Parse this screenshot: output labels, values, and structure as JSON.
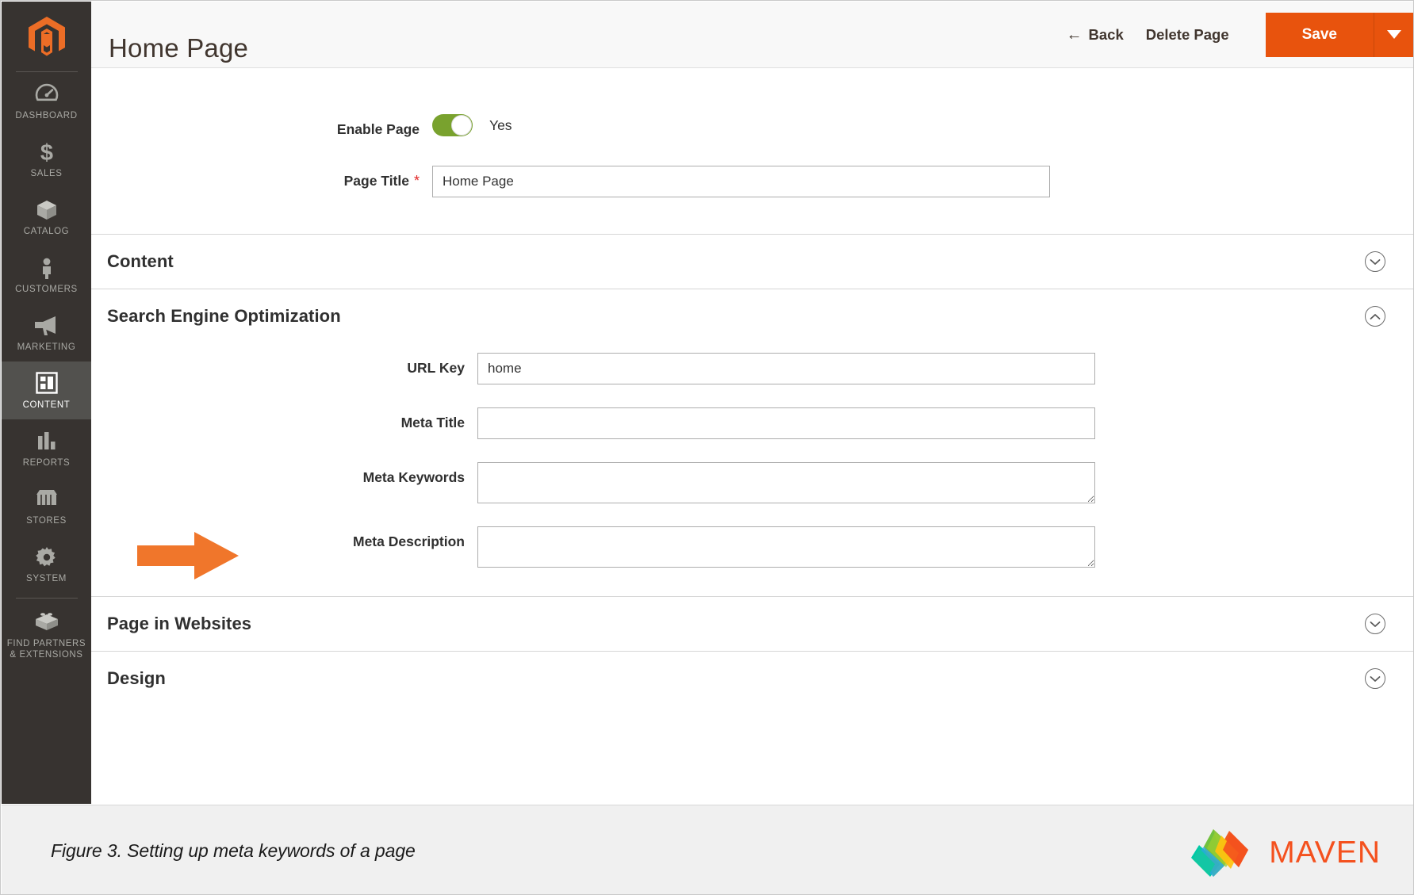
{
  "header": {
    "title": "Home Page",
    "back_label": "Back",
    "back_icon": "arrow-left-icon",
    "delete_label": "Delete Page",
    "save_label": "Save",
    "save_caret_icon": "caret-down-icon"
  },
  "sidebar": {
    "logo_icon": "magento-logo-icon",
    "items": [
      {
        "label": "DASHBOARD",
        "icon": "dashboard-gauge-icon",
        "active": false
      },
      {
        "label": "SALES",
        "icon": "dollar-sign-icon",
        "active": false
      },
      {
        "label": "CATALOG",
        "icon": "box-icon",
        "active": false
      },
      {
        "label": "CUSTOMERS",
        "icon": "person-icon",
        "active": false
      },
      {
        "label": "MARKETING",
        "icon": "megaphone-icon",
        "active": false
      },
      {
        "label": "CONTENT",
        "icon": "layout-page-icon",
        "active": true
      },
      {
        "label": "REPORTS",
        "icon": "bar-chart-icon",
        "active": false
      },
      {
        "label": "STORES",
        "icon": "storefront-icon",
        "active": false
      },
      {
        "label": "SYSTEM",
        "icon": "gear-icon",
        "active": false
      },
      {
        "label": "FIND PARTNERS & EXTENSIONS",
        "icon": "lego-brick-icon",
        "active": false
      }
    ]
  },
  "form": {
    "enable_page": {
      "label": "Enable Page",
      "state_text": "Yes",
      "on": true,
      "track_color": "#79a22e"
    },
    "page_title": {
      "label": "Page Title",
      "required_marker": "*",
      "value": "Home Page",
      "placeholder": ""
    }
  },
  "sections": [
    {
      "id": "content",
      "title": "Content",
      "expanded": false,
      "toggle_icon": "chevron-down-icon"
    },
    {
      "id": "seo",
      "title": "Search Engine Optimization",
      "expanded": true,
      "toggle_icon": "chevron-up-icon"
    },
    {
      "id": "websites",
      "title": "Page in Websites",
      "expanded": false,
      "toggle_icon": "chevron-down-icon"
    },
    {
      "id": "design",
      "title": "Design",
      "expanded": false,
      "toggle_icon": "chevron-down-icon"
    }
  ],
  "seo_fields": {
    "url_key": {
      "label": "URL Key",
      "value": "home",
      "placeholder": ""
    },
    "meta_title": {
      "label": "Meta Title",
      "value": "",
      "placeholder": ""
    },
    "meta_keywords": {
      "label": "Meta Keywords",
      "value": "",
      "placeholder": ""
    },
    "meta_description": {
      "label": "Meta Description",
      "value": "",
      "placeholder": ""
    }
  },
  "annotation": {
    "arrow_icon": "orange-right-arrow-icon",
    "color": "#f0762b",
    "points_to": "Meta Keywords"
  },
  "footer": {
    "caption": "Figure 3. Setting up meta keywords of a page",
    "brand_name": "MAVEN",
    "brand_icon": "maven-diamonds-logo-icon",
    "brand_color": "#f4511e"
  },
  "colors": {
    "accent_orange": "#e8530d",
    "sidebar_bg": "#373330",
    "sidebar_active_bg": "#52514e",
    "header_bg": "#f8f8f8",
    "footer_bg": "#f0f0f0",
    "required_red": "#e22626"
  }
}
